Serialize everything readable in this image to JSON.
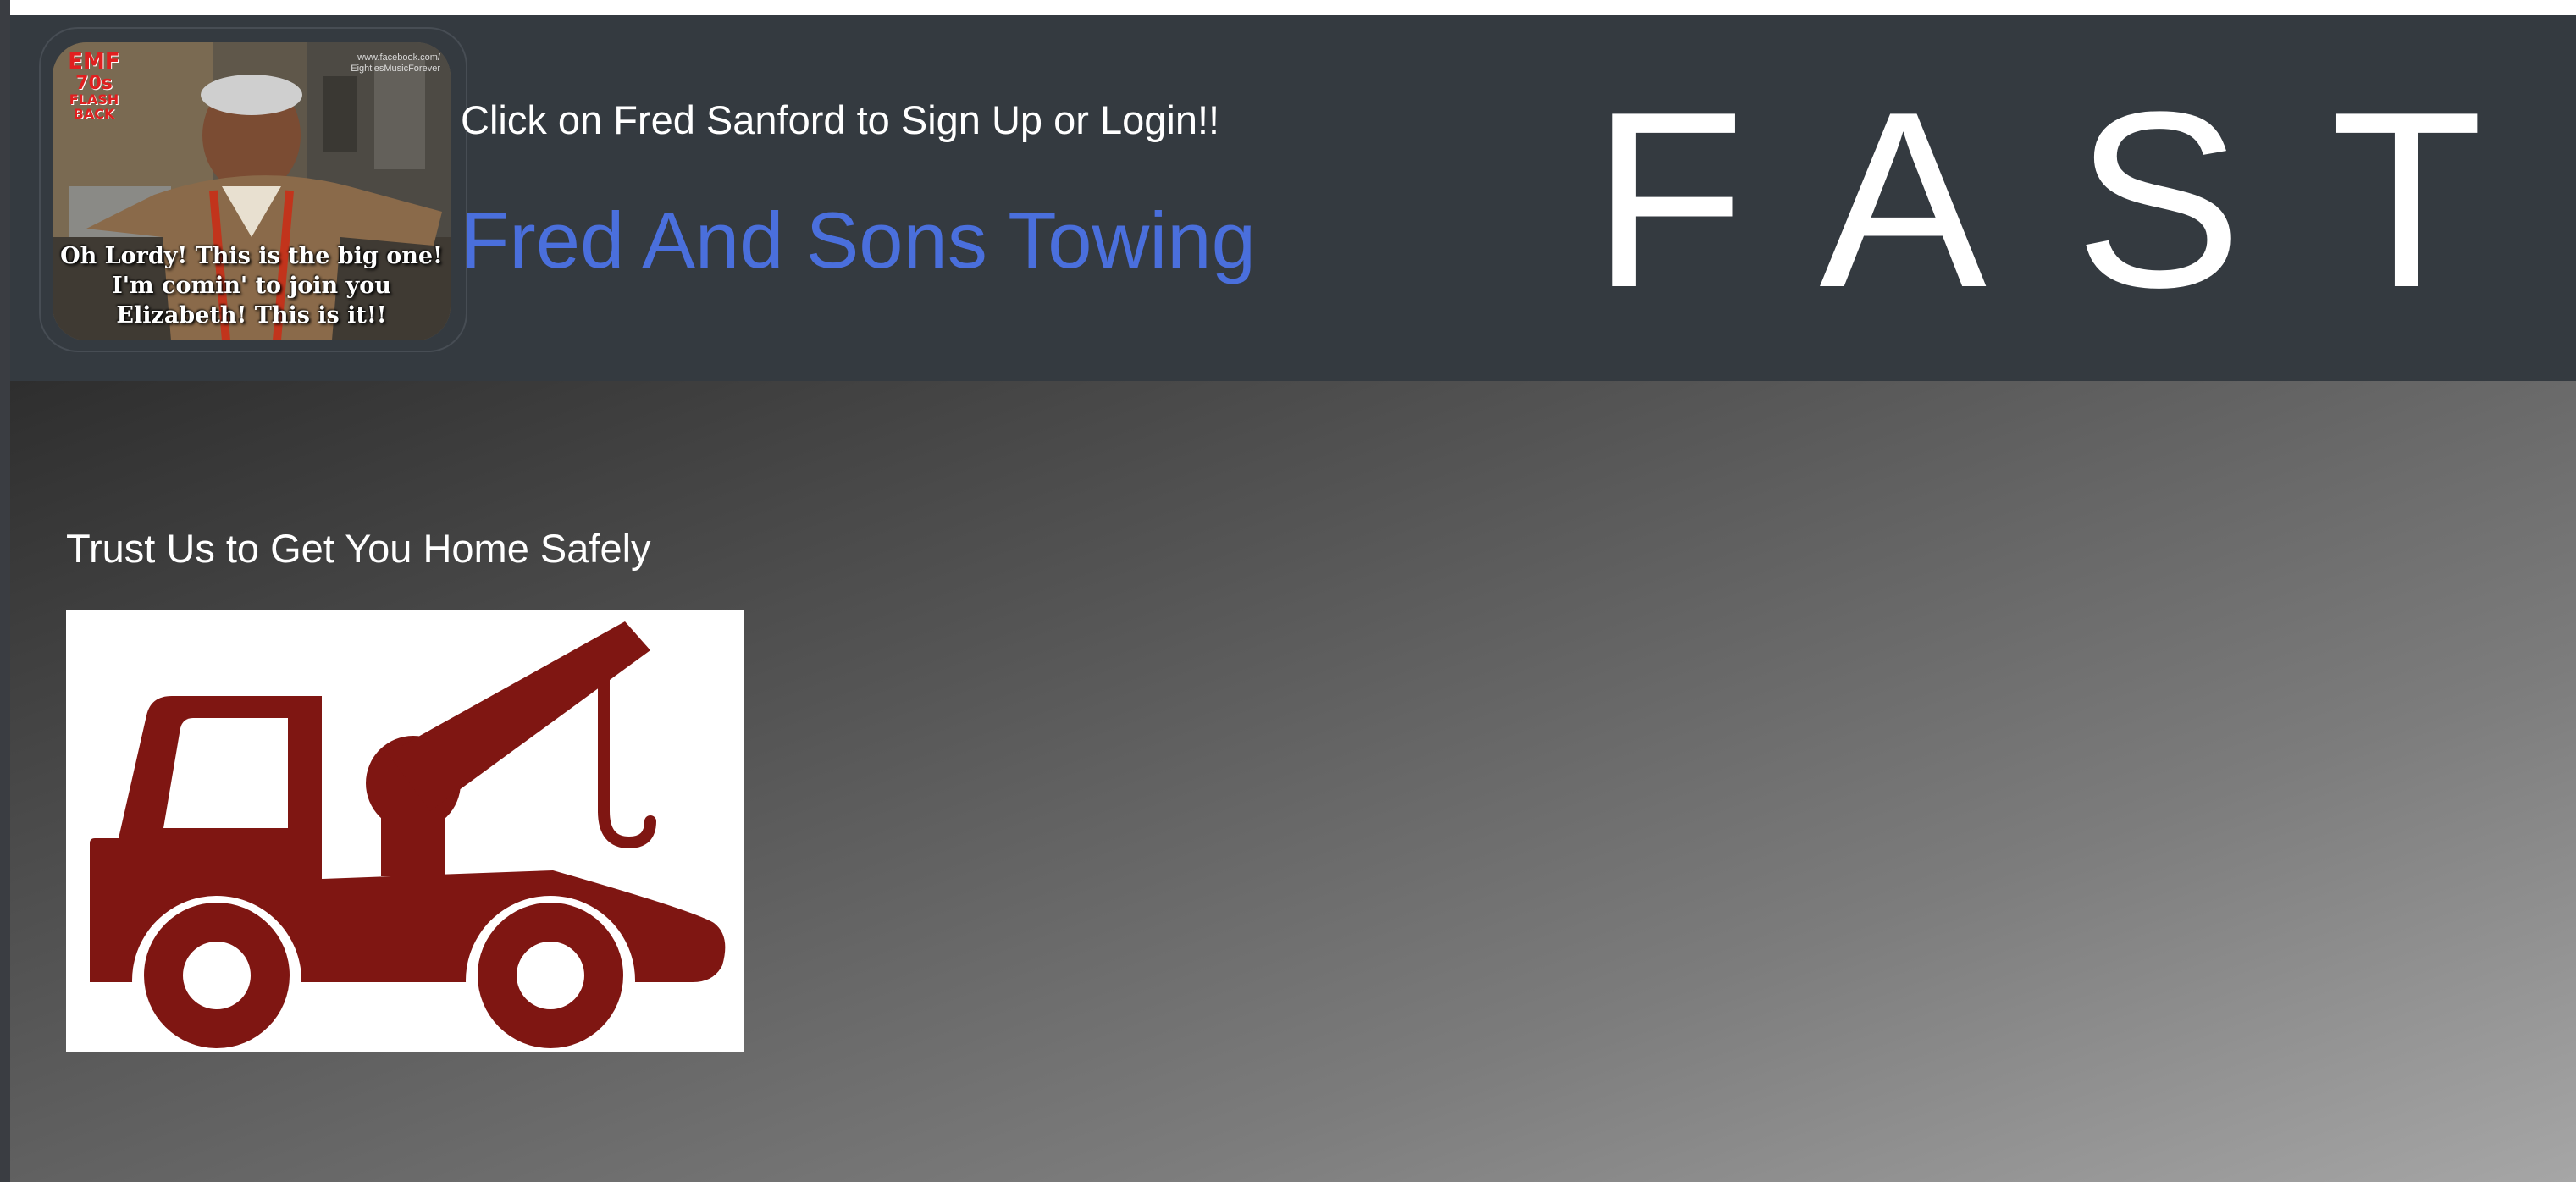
{
  "header": {
    "signup_link": "Click on Fred Sanford to Sign Up or Login!!",
    "title": "Fred And Sons Towing",
    "slogan": "FAST",
    "avatar": {
      "caption_lines": [
        "Oh Lordy! This is the big one!",
        "I'm comin' to join you",
        "Elizabeth! This is it!!"
      ],
      "badge_lines": [
        "EMF",
        "70s",
        "FLASH BACK"
      ],
      "watermark_lines": [
        "www.facebook.com/",
        "EightiesMusicForever"
      ]
    }
  },
  "main": {
    "tagline": "Trust Us to Get You Home Safely",
    "truck_icon": "tow-truck-icon"
  },
  "colors": {
    "header_bg": "#343a40",
    "title_blue": "#4a6fdc",
    "truck_red": "#7f1612",
    "text_white": "#ffffff"
  }
}
